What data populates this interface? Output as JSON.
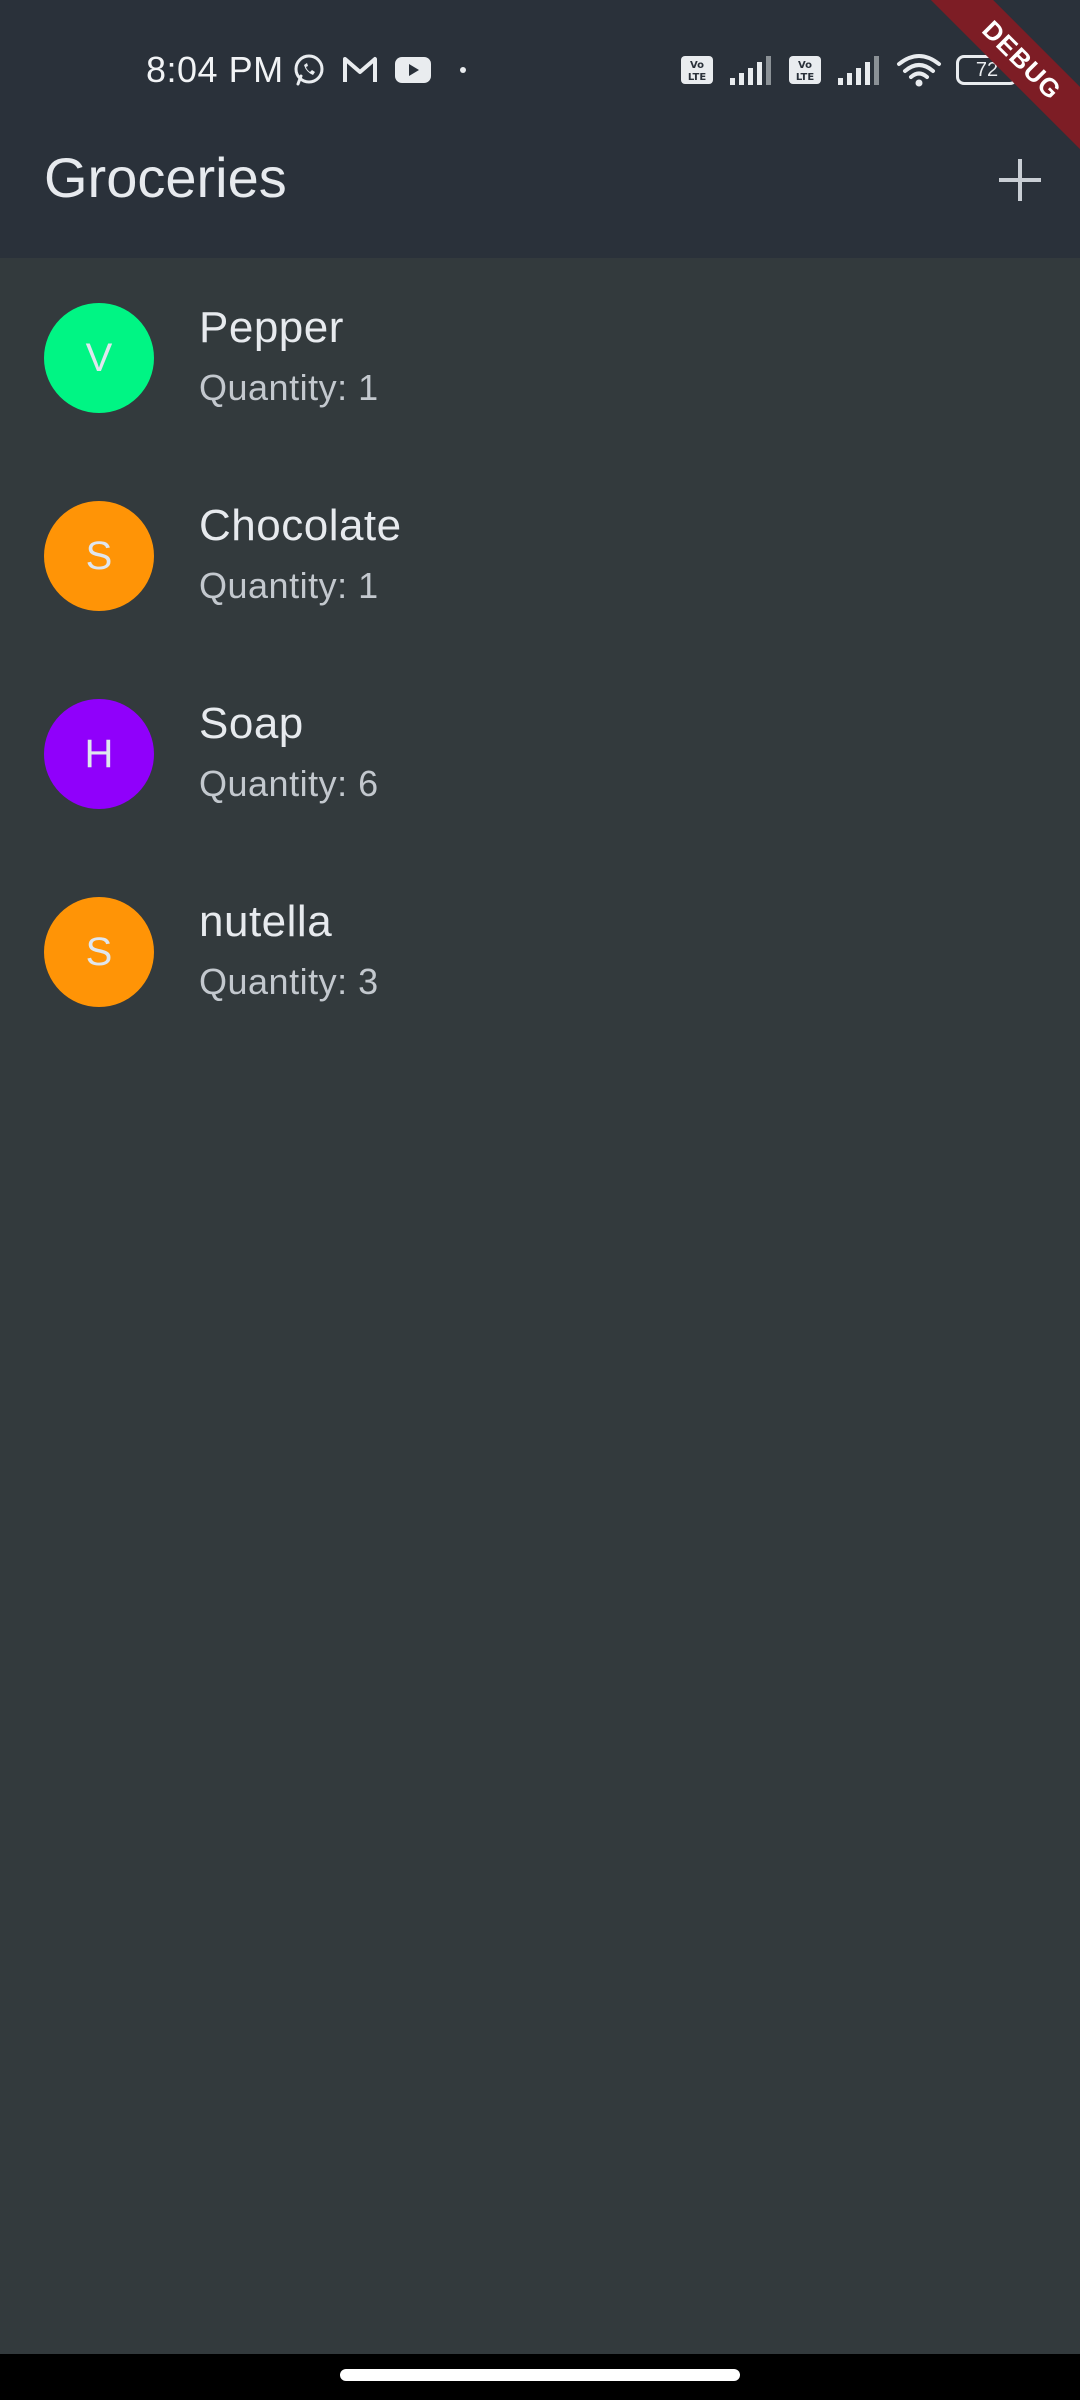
{
  "status_bar": {
    "time": "8:04 PM",
    "notification_icons": [
      "whatsapp-icon",
      "gmail-icon",
      "youtube-icon",
      "dot-icon"
    ],
    "system_icons": [
      "volte-icon",
      "signal-icon",
      "volte-icon",
      "signal-icon",
      "wifi-icon"
    ],
    "battery_level": "72"
  },
  "app_bar": {
    "title": "Groceries",
    "action_icon": "plus-icon"
  },
  "debug_banner": {
    "label": "DEBUG",
    "color": "#7d1d25"
  },
  "groceries": {
    "items": [
      {
        "avatar_letter": "V",
        "avatar_color": "#00f584",
        "name": "Pepper",
        "quantity": "Quantity: 1"
      },
      {
        "avatar_letter": "S",
        "avatar_color": "#ff9406",
        "name": "Chocolate",
        "quantity": "Quantity: 1"
      },
      {
        "avatar_letter": "H",
        "avatar_color": "#9000fb",
        "name": "Soap",
        "quantity": "Quantity: 6"
      },
      {
        "avatar_letter": "S",
        "avatar_color": "#ff9406",
        "name": "nutella",
        "quantity": "Quantity: 3"
      }
    ]
  },
  "colors": {
    "header_background": "#2a313a",
    "body_background": "#333a3d",
    "text_primary": "#e7eaee",
    "text_secondary": "#c3c8ce"
  }
}
